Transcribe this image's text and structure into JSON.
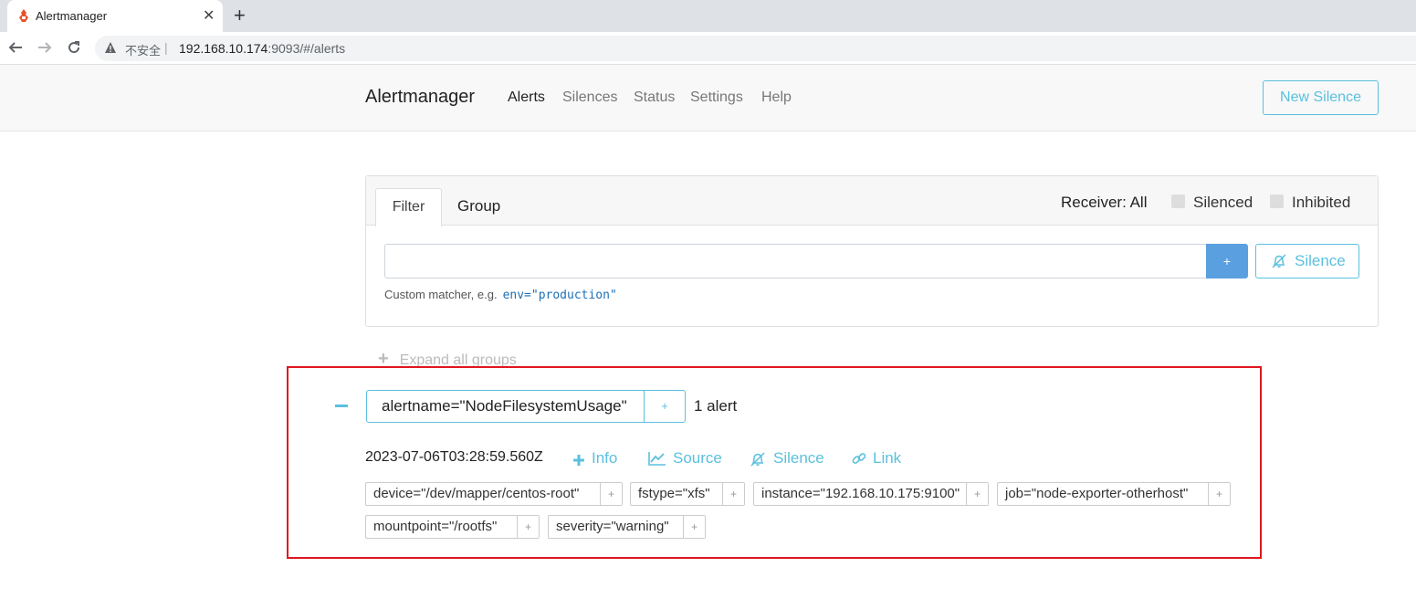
{
  "browser": {
    "tab_title": "Alertmanager",
    "close": "✕",
    "new_tab": "+",
    "insecure_label": "不安全",
    "url_host": "192.168.10.174",
    "url_rest": ":9093/#/alerts"
  },
  "navbar": {
    "brand": "Alertmanager",
    "links": [
      "Alerts",
      "Silences",
      "Status",
      "Settings",
      "Help"
    ],
    "new_silence": "New Silence"
  },
  "filter_card": {
    "tabs": [
      "Filter",
      "Group"
    ],
    "receiver": "Receiver: All",
    "silenced": "Silenced",
    "inhibited": "Inhibited",
    "matcher_value": "",
    "add_label": "+",
    "silence_label": "Silence",
    "hint_text": "Custom matcher, e.g.",
    "hint_example": "env=\"production\""
  },
  "expand_all": "Expand all groups",
  "group": {
    "label": "alertname=\"NodeFilesystemUsage\"",
    "add": "+",
    "count": "1 alert"
  },
  "alert": {
    "timestamp": "2023-07-06T03:28:59.560Z",
    "actions": [
      "Info",
      "Source",
      "Silence",
      "Link"
    ],
    "labels": [
      "device=\"/dev/mapper/centos-root\"",
      "fstype=\"xfs\"",
      "instance=\"192.168.10.175:9100\"",
      "job=\"node-exporter-otherhost\"",
      "mountpoint=\"/rootfs\"",
      "severity=\"warning\""
    ]
  },
  "colors": {
    "accent": "#5bc0de",
    "highlight": "#e0161d",
    "primary_button": "#5aa0e0"
  }
}
